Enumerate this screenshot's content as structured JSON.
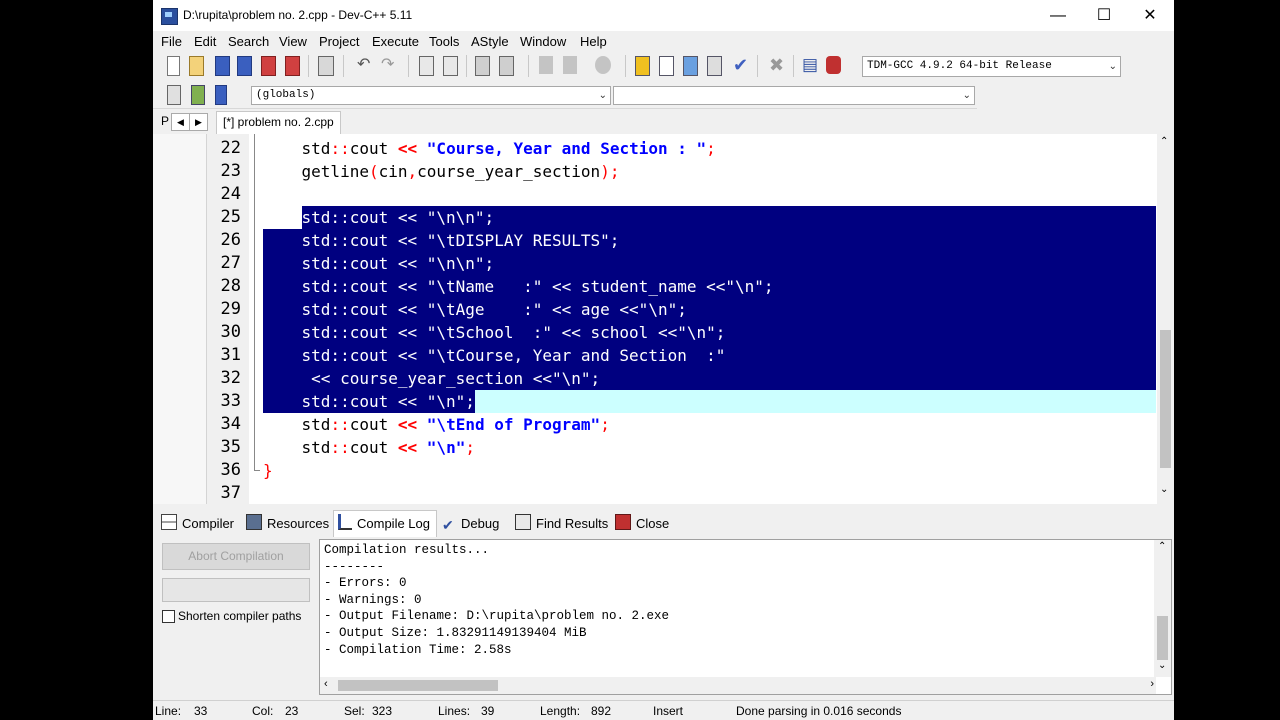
{
  "window": {
    "title": "D:\\rupita\\problem no. 2.cpp - Dev-C++ 5.11"
  },
  "menu": [
    "File",
    "Edit",
    "Search",
    "View",
    "Project",
    "Execute",
    "Tools",
    "AStyle",
    "Window",
    "Help"
  ],
  "toolbar": {
    "compiler": "TDM-GCC 4.9.2 64-bit Release",
    "scope": "(globals)",
    "member": ""
  },
  "tabs": {
    "left_stub": "P",
    "document": "[*] problem no. 2.cpp"
  },
  "editor": {
    "lines": [
      {
        "num": "22",
        "code": "    std::cout << \"Course, Year and Section : \";"
      },
      {
        "num": "23",
        "code": "    getline(cin,course_year_section);"
      },
      {
        "num": "24",
        "code": ""
      },
      {
        "num": "25",
        "code": "    std::cout << \"\\n\\n\";"
      },
      {
        "num": "26",
        "code": "    std::cout << \"\\tDISPLAY RESULTS\";"
      },
      {
        "num": "27",
        "code": "    std::cout << \"\\n\\n\";"
      },
      {
        "num": "28",
        "code": "    std::cout << \"\\tName   :\" << student_name <<\"\\n\";"
      },
      {
        "num": "29",
        "code": "    std::cout << \"\\tAge    :\" << age <<\"\\n\";"
      },
      {
        "num": "30",
        "code": "    std::cout << \"\\tSchool  :\" << school <<\"\\n\";"
      },
      {
        "num": "31",
        "code": "    std::cout << \"\\tCourse, Year and Section  :\""
      },
      {
        "num": "32",
        "code": "     << course_year_section <<\"\\n\";"
      },
      {
        "num": "33",
        "code": "    std::cout << \"\\n\";"
      },
      {
        "num": "34",
        "code": "    std::cout << \"\\tEnd of Program\";"
      },
      {
        "num": "35",
        "code": "    std::cout << \"\\n\";"
      },
      {
        "num": "36",
        "code": "}"
      },
      {
        "num": "37",
        "code": ""
      }
    ]
  },
  "bottom_tabs": [
    "Compiler",
    "Resources",
    "Compile Log",
    "Debug",
    "Find Results",
    "Close"
  ],
  "compile": {
    "abort_label": "Abort Compilation",
    "shorten_label": "Shorten compiler paths",
    "log": [
      "Compilation results...",
      "--------",
      "- Errors: 0",
      "- Warnings: 0",
      "- Output Filename: D:\\rupita\\problem no. 2.exe",
      "- Output Size: 1.83291149139404 MiB",
      "- Compilation Time: 2.58s"
    ]
  },
  "status": {
    "line_label": "Line:",
    "line": "33",
    "col_label": "Col:",
    "col": "23",
    "sel_label": "Sel:",
    "sel": "323",
    "lines_label": "Lines:",
    "lines": "39",
    "length_label": "Length:",
    "length": "892",
    "mode": "Insert",
    "message": "Done parsing in 0.016 seconds"
  },
  "colors": {
    "selection": "#000080",
    "current_line": "#ccffff",
    "keyword_symbol": "#ff0000",
    "string": "#0000ff",
    "brace": "#ff0000",
    "background_letterbox": "#000000"
  }
}
